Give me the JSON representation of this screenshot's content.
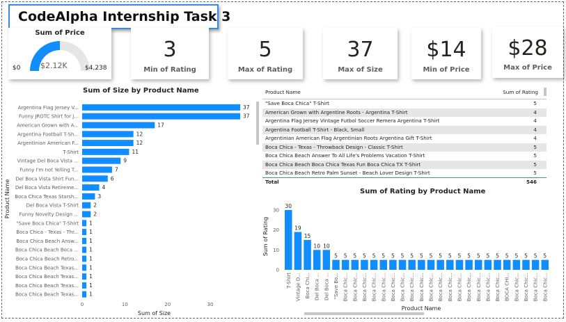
{
  "title": "CodeAlpha Internship Task 3",
  "gauge": {
    "title": "Sum of Price",
    "value_label": "$2.12K",
    "min_label": "$0",
    "max_label": "$4,238",
    "value": 2120,
    "max": 4238,
    "fill_color": "#118DFF",
    "track_color": "#E6E6E6"
  },
  "cards": [
    {
      "value": "3",
      "label": "Min of Rating"
    },
    {
      "value": "5",
      "label": "Max of Rating"
    },
    {
      "value": "37",
      "label": "Max of Size"
    },
    {
      "value": "$14",
      "label": "Min of Price"
    },
    {
      "value": "$28",
      "label": "Max of Price"
    }
  ],
  "table": {
    "col1": "Product Name",
    "col2": "Sum of Rating",
    "rows": [
      {
        "name": "\"Save Boca Chica\" T-Shirt",
        "value": "5"
      },
      {
        "name": "American Grown with Argentine Roots - Argentina T-Shirt",
        "value": "4"
      },
      {
        "name": "Argentina Flag Jersey Vintage Futbol Soccer Remera Argentina T-Shirt",
        "value": "4"
      },
      {
        "name": "Argentina Football T-Shirt - Black, Small",
        "value": "4"
      },
      {
        "name": "Argentinian American Flag Argentinian Roots Argentina Gift T-Shirt",
        "value": "4"
      },
      {
        "name": "Boca Chica - Texas - Throwback Design - Classic T-Shirt",
        "value": "5"
      },
      {
        "name": "Boca Chica Beach Answer To All Life's Problems Vacation T-Shirt",
        "value": "5"
      },
      {
        "name": "Boca Chica Beach Boca Chica Texas Fun Boca Chica TX T-Shirt",
        "value": "5"
      },
      {
        "name": "Boca Chica Beach Retro Palm Sunset - Beach Lover Design T-Shirt",
        "value": "5"
      }
    ],
    "total_label": "Total",
    "total_value": "546"
  },
  "chart_data": [
    {
      "type": "bar",
      "orientation": "horizontal",
      "title": "Sum of Size by Product Name",
      "xlabel": "Sum of Size",
      "ylabel": "Product Name",
      "xlim": [
        0,
        37
      ],
      "xticks": [
        0,
        10,
        20,
        30
      ],
      "bar_color": "#118DFF",
      "categories": [
        "Argentina Flag Jersey V...",
        "Funny JROTC Shirt for J...",
        "American Grown with A...",
        "Argentina Football T-Sh...",
        "Argentinian American F...",
        "T-Shirt",
        "Vintage Del Boca Vista ...",
        "Funny I'm not Yelling T...",
        "Del Boca Vista Shirt Fun...",
        "Del Boca Vista Retireme...",
        "Boca Chica Texas Starsh...",
        "Del Boca Vista T-Shirt",
        "Funny Novelty Design ...",
        "\"Save Boca Chica\" T-Shirt",
        "Boca Chica - Texas - Thr...",
        "Boca Chica Beach Answ...",
        "Boca Chica Beach Boca ...",
        "Boca Chica Beach Retro...",
        "Boca Chica Beach Texas...",
        "Boca Chica Beach Texas...",
        "Boca Chica Beach Texas...",
        "Boca Chica Beach Texas..."
      ],
      "values": [
        37,
        37,
        17,
        12,
        12,
        11,
        9,
        7,
        6,
        4,
        3,
        2,
        2,
        1,
        1,
        1,
        1,
        1,
        1,
        1,
        1,
        1
      ]
    },
    {
      "type": "bar",
      "orientation": "vertical",
      "title": "Sum of Rating by Product Name",
      "xlabel": "Product Name",
      "ylabel": "Sum of Rating",
      "ylim": [
        0,
        30
      ],
      "yticks": [
        0,
        10,
        20,
        30
      ],
      "bar_color": "#118DFF",
      "categories": [
        "T-Shirt",
        "Vintage D...",
        "Boca Chi...",
        "Del Boca ...",
        "Del Boca ...",
        "\"Save Bo...",
        "Boca Chic...",
        "Boca Chic...",
        "Boca Chic...",
        "Boca Chic...",
        "Boca Chic...",
        "Boca Chic...",
        "Boca Chic...",
        "Boca Chic...",
        "Boca Chic...",
        "Boca Chic...",
        "Boca Chic...",
        "Boca Chic...",
        "Boca Chic...",
        "Boca Chic...",
        "Boca Chic...",
        "Boca Chic...",
        "Boca Chic...",
        "BOCA CHI...",
        "Boca Chic...",
        "Boca Chic...",
        "Boca Chic...",
        "Boca Chic..."
      ],
      "values": [
        30,
        19,
        15,
        10,
        10,
        5,
        5,
        5,
        5,
        5,
        5,
        5,
        5,
        5,
        5,
        5,
        5,
        5,
        5,
        5,
        5,
        5,
        5,
        5,
        5,
        5,
        5,
        5
      ]
    }
  ]
}
